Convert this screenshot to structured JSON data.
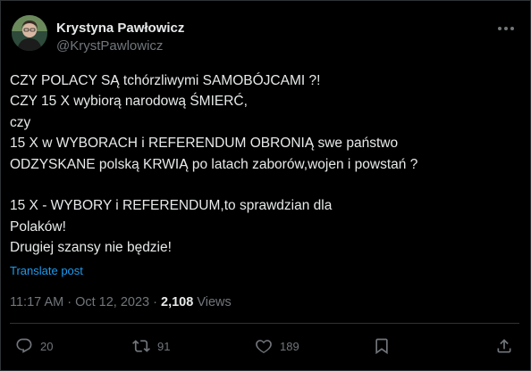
{
  "author": {
    "display_name": "Krystyna Pawłowicz",
    "handle": "@KrystPawlowicz",
    "avatar_icon": "profile-photo"
  },
  "tweet": {
    "lines": [
      "CZY  POLACY  SĄ  tchórzliwymi SAMOBÓJCAMI ?!",
      "CZY 15 X wybiorą narodową  ŚMIERĆ,",
      "czy",
      "15 X w WYBORACH i REFERENDUM OBRONIĄ swe państwo",
      "ODZYSKANE polską KRWIĄ po latach zaborów,wojen i powstań ?",
      "",
      "15 X - WYBORY i REFERENDUM,to sprawdzian dla",
      "Polaków!",
      "Drugiej szansy nie będzie!"
    ],
    "translate_label": "Translate post"
  },
  "meta": {
    "time": "11:17 AM",
    "separator": " · ",
    "date": "Oct 12, 2023",
    "views_count": "2,108",
    "views_label": " Views"
  },
  "actions": {
    "reply": {
      "icon": "reply-icon",
      "count": "20"
    },
    "repost": {
      "icon": "repost-icon",
      "count": "91"
    },
    "like": {
      "icon": "like-icon",
      "count": "189"
    },
    "bookmark": {
      "icon": "bookmark-icon"
    },
    "share": {
      "icon": "share-icon"
    }
  },
  "colors": {
    "background": "#000000",
    "text": "#e7e9ea",
    "muted": "#71767b",
    "link": "#1d9bf0",
    "border": "#2f3336"
  }
}
